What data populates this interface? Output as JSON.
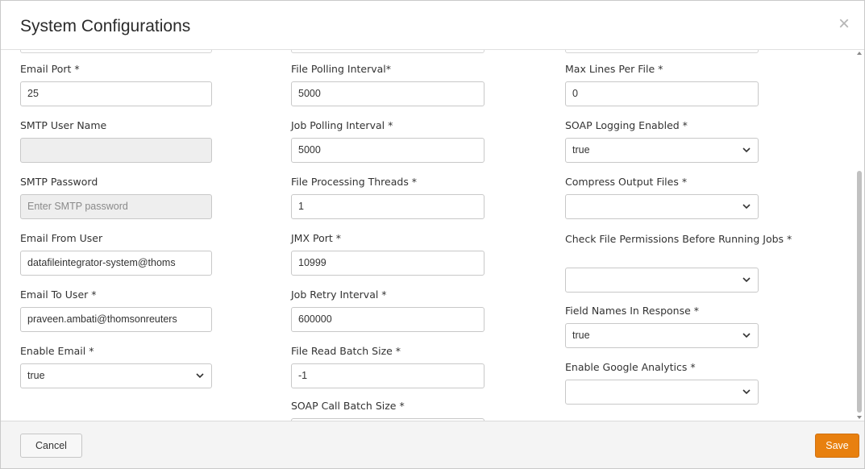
{
  "modal": {
    "title": "System Configurations",
    "close_symbol": "×"
  },
  "columns": [
    {
      "fields": [
        {
          "label": "Email Port *",
          "type": "text",
          "value": "25"
        },
        {
          "label": "SMTP User Name",
          "type": "text",
          "value": "",
          "disabled": true
        },
        {
          "label": "SMTP Password",
          "type": "password",
          "value": "",
          "placeholder": "Enter SMTP password",
          "disabled": true
        },
        {
          "label": "Email From User",
          "type": "text",
          "value": "datafileintegrator-system@thoms"
        },
        {
          "label": "Email To User *",
          "type": "text",
          "value": "praveen.ambati@thomsonreuters"
        },
        {
          "label": "Enable Email *",
          "type": "select",
          "value": "true"
        }
      ]
    },
    {
      "fields": [
        {
          "label": "File Polling Interval*",
          "type": "text",
          "value": "5000"
        },
        {
          "label": "Job Polling Interval *",
          "type": "text",
          "value": "5000"
        },
        {
          "label": "File Processing Threads *",
          "type": "text",
          "value": "1"
        },
        {
          "label": "JMX Port *",
          "type": "text",
          "value": "10999"
        },
        {
          "label": "Job Retry Interval *",
          "type": "text",
          "value": "600000"
        },
        {
          "label": "File Read Batch Size *",
          "type": "text",
          "value": "-1"
        },
        {
          "label": "SOAP Call Batch Size *",
          "type": "text",
          "value": ""
        }
      ]
    },
    {
      "fields": [
        {
          "label": "Max Lines Per File *",
          "type": "text",
          "value": "0"
        },
        {
          "label": "SOAP Logging Enabled *",
          "type": "select",
          "value": "true"
        },
        {
          "label": "Compress Output Files *",
          "type": "select",
          "value": ""
        },
        {
          "label": "Check File Permissions Before Running Jobs *",
          "type": "select",
          "value": ""
        },
        {
          "label": "Field Names In Response *",
          "type": "select",
          "value": "true"
        },
        {
          "label": "Enable Google Analytics *",
          "type": "select",
          "value": ""
        }
      ]
    }
  ],
  "footer": {
    "cancel_label": "Cancel",
    "save_label": "Save"
  },
  "colors": {
    "save_button": "#e8800f",
    "disabled_input": "#eeeeee",
    "border": "#c8c8c8"
  }
}
